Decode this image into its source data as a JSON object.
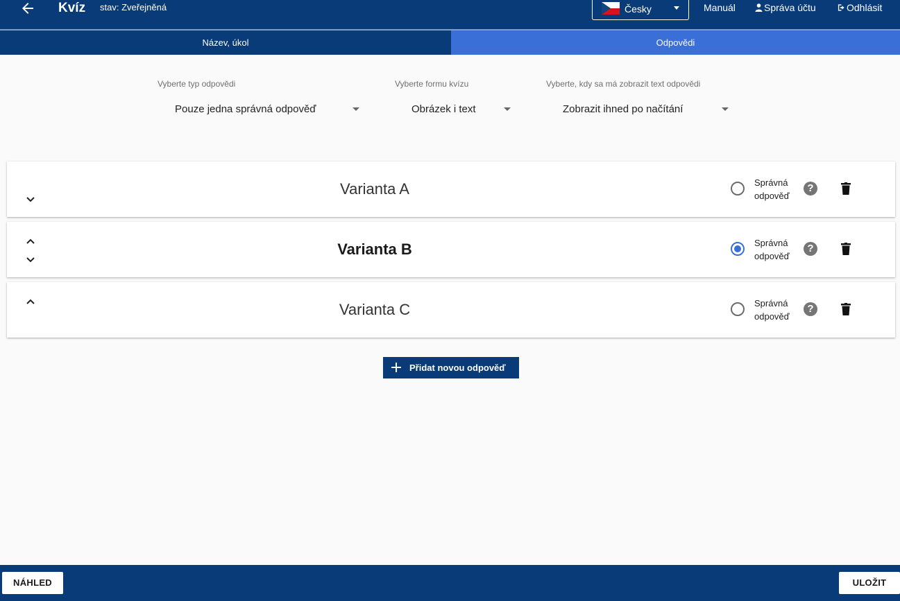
{
  "header": {
    "title": "Kvíz",
    "status": "stav: Zveřejněná",
    "language": "Česky",
    "links": {
      "manual": "Manuál",
      "account": "Správa účtu",
      "logout": "Odhlásit"
    }
  },
  "tabs": [
    {
      "label": "Název, úkol",
      "active": false
    },
    {
      "label": "Odpovědi",
      "active": true
    }
  ],
  "selects": {
    "answer_type": {
      "label": "Vyberte typ odpovědi",
      "value": "Pouze jedna správná odpověď"
    },
    "quiz_form": {
      "label": "Vyberte formu kvízu",
      "value": "Obrázek i text"
    },
    "show_text": {
      "label": "Vyberte, kdy sa má zobrazit text odpovědi",
      "value": "Zobrazit ihned po načítání"
    }
  },
  "variants": [
    {
      "title": "Varianta A",
      "correct": false,
      "correct_label": "Správná odpověď"
    },
    {
      "title": "Varianta B",
      "correct": true,
      "correct_label": "Správná odpověď"
    },
    {
      "title": "Varianta C",
      "correct": false,
      "correct_label": "Správná odpověď"
    }
  ],
  "add_button": "Přidat novou odpověď",
  "footer": {
    "preview": "NÁHLED",
    "save": "ULOŽIT"
  },
  "colors": {
    "primary": "#083b77",
    "accent": "#3a6fd8"
  },
  "icons": [
    "arrow-left-icon",
    "czech-flag-icon",
    "user-icon",
    "logout-icon",
    "chevron-up-icon",
    "chevron-down-icon",
    "help-icon",
    "trash-icon",
    "plus-icon"
  ]
}
